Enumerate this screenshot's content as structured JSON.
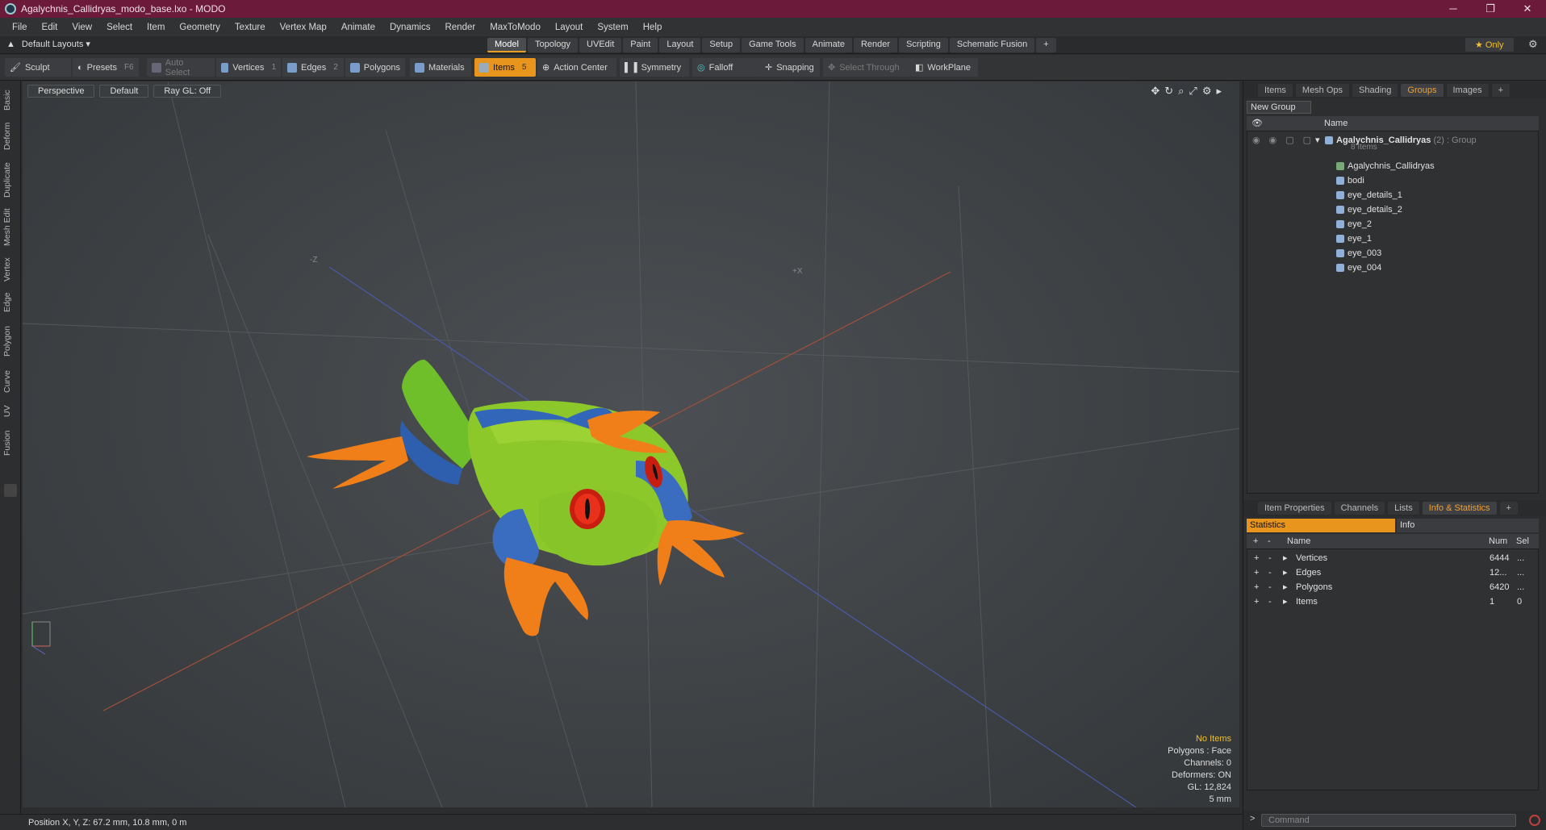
{
  "window": {
    "title": "Agalychnis_Callidryas_modo_base.lxo - MODO",
    "controls": [
      "─",
      "❐",
      "✕"
    ]
  },
  "menu": [
    "File",
    "Edit",
    "View",
    "Select",
    "Item",
    "Geometry",
    "Texture",
    "Vertex Map",
    "Animate",
    "Dynamics",
    "Render",
    "MaxToModo",
    "Layout",
    "System",
    "Help"
  ],
  "layouts": {
    "label": "Default Layouts ▾"
  },
  "mode_tabs": [
    "Model",
    "Topology",
    "UVEdit",
    "Paint",
    "Layout",
    "Setup",
    "Game Tools",
    "Animate",
    "Render",
    "Scripting",
    "Schematic Fusion",
    "+"
  ],
  "only_label": "★ Only",
  "tools": {
    "sculpt": "Sculpt",
    "presets": "Presets",
    "presets_key": "F6",
    "auto_select": "Auto Select",
    "vertices": "Vertices",
    "vertices_key": "1",
    "edges": "Edges",
    "edges_key": "2",
    "polygons": "Polygons",
    "materials": "Materials",
    "items": "Items",
    "items_key": "5",
    "action_center": "Action Center",
    "symmetry": "Symmetry",
    "falloff": "Falloff",
    "snapping": "Snapping",
    "select_through": "Select Through",
    "workplane": "WorkPlane"
  },
  "left_tabs": [
    "Basic",
    "Deform",
    "Duplicate",
    "Mesh Edit",
    "Vertex",
    "Edge",
    "Polygon",
    "Curve",
    "UV",
    "Fusion"
  ],
  "viewport": {
    "view": "Perspective",
    "shading": "Default",
    "raygl": "Ray GL: Off",
    "stats": [
      "No Items",
      "Polygons : Face",
      "Channels: 0",
      "Deformers: ON",
      "GL: 12,824",
      "5 mm"
    ],
    "axis_labels": {
      "z": "-Z",
      "x": "+X"
    }
  },
  "statusbar": "Position X, Y, Z:   67.2 mm, 10.8 mm, 0 m",
  "right_panel": {
    "top_tabs": [
      "Items",
      "Mesh Ops",
      "Shading",
      "Groups",
      "Images",
      "+"
    ],
    "active_top": "Groups",
    "new_group": "New Group",
    "name_header": "Name",
    "group": {
      "name": "Agalychnis_Callidryas",
      "suffix": " (2) : Group",
      "count": "8 Items"
    },
    "items": [
      "Agalychnis_Callidryas",
      "bodi",
      "eye_details_1",
      "eye_details_2",
      "eye_2",
      "eye_1",
      "eye_003",
      "eye_004"
    ],
    "bottom_tabs": [
      "Item Properties",
      "Channels",
      "Lists",
      "Info & Statistics",
      "+"
    ],
    "active_bottom": "Info & Statistics",
    "statistics_label": "Statistics",
    "info_label": "Info",
    "stat_headers": {
      "name": "Name",
      "num": "Num",
      "sel": "Sel"
    },
    "stats": [
      {
        "name": "Vertices",
        "num": "6444",
        "sel": "..."
      },
      {
        "name": "Edges",
        "num": "12...",
        "sel": "..."
      },
      {
        "name": "Polygons",
        "num": "6420",
        "sel": "..."
      },
      {
        "name": "Items",
        "num": "1",
        "sel": "0"
      }
    ],
    "command_placeholder": "Command"
  }
}
